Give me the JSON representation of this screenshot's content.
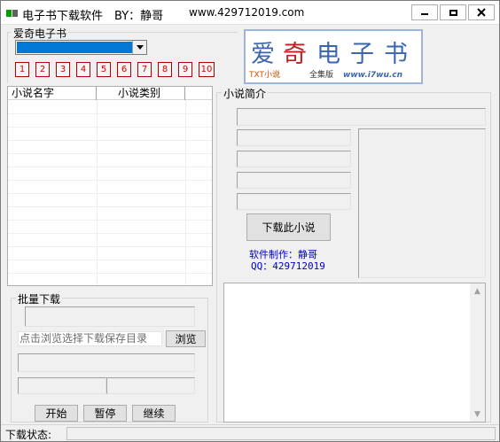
{
  "window": {
    "title": "电子书下载软件　BY：静哥",
    "url": "www.429712019.com",
    "controls": {
      "minimize": "▁",
      "maximize": "▣",
      "close": "✕"
    },
    "icon_colors": [
      "#00a000",
      "#606060"
    ]
  },
  "source_group": {
    "label": "爱奇电子书",
    "dropdown_value": "",
    "pages": [
      "1",
      "2",
      "3",
      "4",
      "5",
      "6",
      "7",
      "8",
      "9",
      "10"
    ]
  },
  "logo": {
    "chars": [
      "爱",
      "奇",
      "电",
      "子",
      "书"
    ],
    "sub_left": "TXT小说",
    "sub_mid": "全集版",
    "sub_right": "www.i7wu.cn"
  },
  "novel_list": {
    "columns": [
      "小说名字",
      "小说类别"
    ]
  },
  "intro_group": {
    "label": "小说简介",
    "download_button": "下载此小说",
    "credit_author": "软件制作：静哥",
    "credit_qq": "QQ：429712019"
  },
  "batch_group": {
    "label": "批量下载",
    "path_placeholder": "点击浏览选择下载保存目录",
    "browse_button": "浏览",
    "start_button": "开始",
    "pause_button": "暂停",
    "resume_button": "继续"
  },
  "status": {
    "label": "下载状态:",
    "value": ""
  },
  "colors": {
    "selection": "#0078d7",
    "page_button_text": "#d00000",
    "credit_text": "#0000cc",
    "logo_blue": "#3a66b0"
  }
}
